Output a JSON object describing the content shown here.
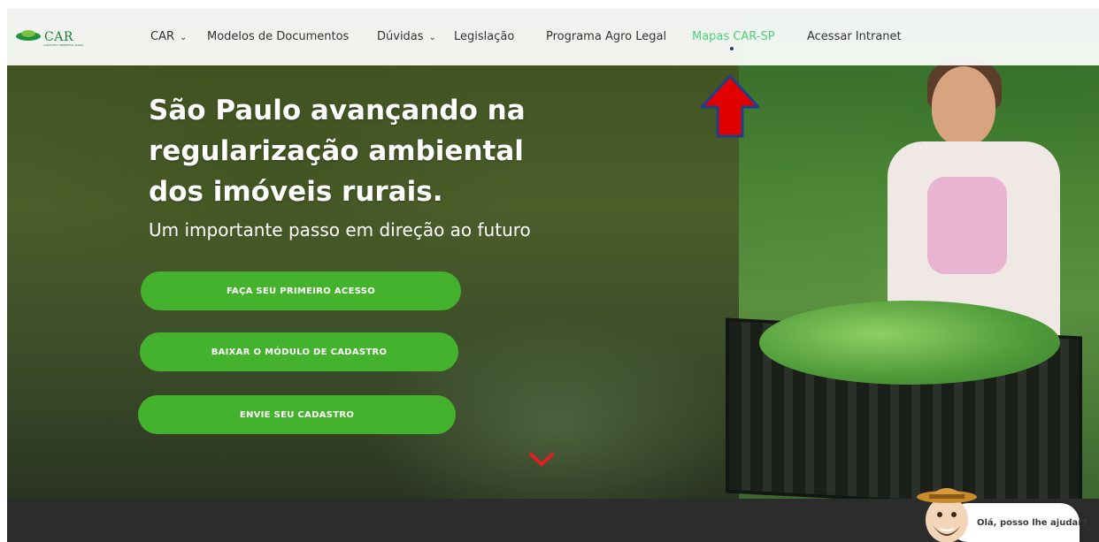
{
  "logo": {
    "name": "CAR",
    "tagline": "CADASTRO AMBIENTAL RURAL"
  },
  "nav": {
    "items": [
      {
        "label": "CAR",
        "has_dropdown": true
      },
      {
        "label": "Modelos de Documentos",
        "has_dropdown": false
      },
      {
        "label": "Dúvidas",
        "has_dropdown": true
      },
      {
        "label": "Legislação",
        "has_dropdown": false
      },
      {
        "label": "Programa Agro Legal",
        "has_dropdown": false
      },
      {
        "label": "Mapas CAR-SP",
        "has_dropdown": false,
        "active": true
      },
      {
        "label": "Acessar Intranet",
        "has_dropdown": false
      }
    ],
    "active_color": "#4cd07a"
  },
  "hero": {
    "title_lines": [
      "São Paulo avançando na",
      "regularização ambiental",
      "dos imóveis rurais."
    ],
    "subtitle": "Um importante passo em direção ao futuro",
    "buttons": [
      {
        "label": "FAÇA SEU PRIMEIRO ACESSO"
      },
      {
        "label": "BAIXAR O MÓDULO DE CADASTRO"
      },
      {
        "label": "ENVIE SEU CADASTRO"
      }
    ],
    "button_color": "#45b22e",
    "scroll_icon": "chevron-down-icon"
  },
  "annotation": {
    "icon": "red-arrow-up-icon",
    "color": "#e00000"
  },
  "chat": {
    "message": "Olá, posso lhe ajudar?",
    "icon": "farmer-avatar-icon"
  }
}
